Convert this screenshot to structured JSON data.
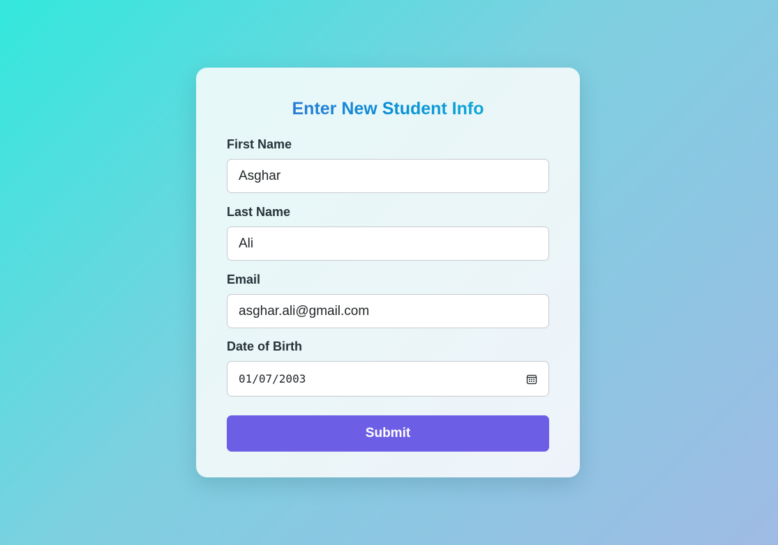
{
  "form": {
    "title": "Enter New Student Info",
    "fields": {
      "first_name": {
        "label": "First Name",
        "value": "Asghar"
      },
      "last_name": {
        "label": "Last Name",
        "value": "Ali"
      },
      "email": {
        "label": "Email",
        "value": "asghar.ali@gmail.com"
      },
      "dob": {
        "label": "Date of Birth",
        "value": "01/07/2003",
        "icon": "calendar-icon"
      }
    },
    "submit_label": "Submit"
  },
  "colors": {
    "accent": "#6d5ee6",
    "title_gradient_start": "#3f6fd6",
    "title_gradient_end": "#13b7d6",
    "background_start": "#33e8dc",
    "background_end": "#9fbbe4"
  }
}
